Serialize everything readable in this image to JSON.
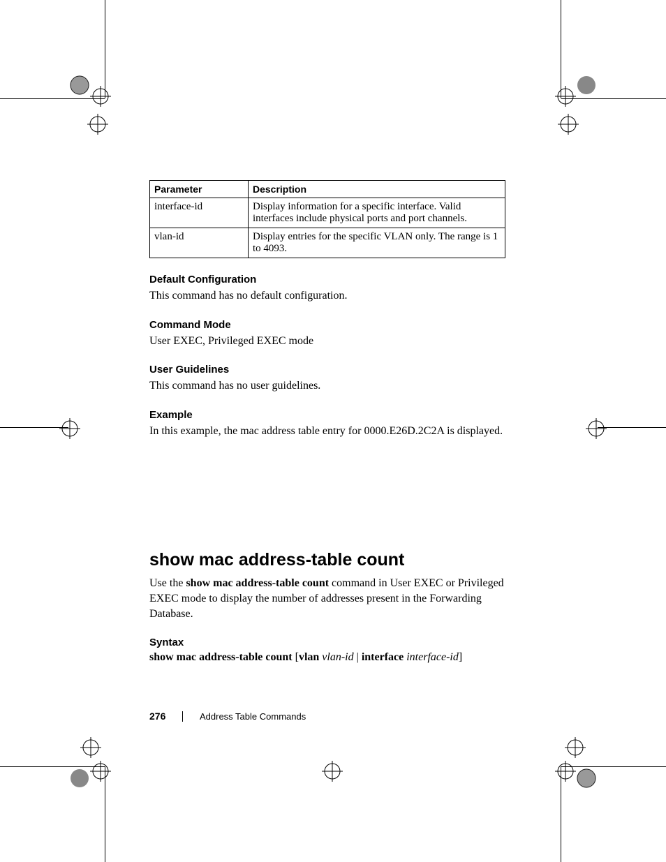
{
  "table": {
    "headers": {
      "param": "Parameter",
      "desc": "Description"
    },
    "rows": [
      {
        "param": "interface-id",
        "desc": "Display information for a specific interface. Valid interfaces include physical ports and port channels."
      },
      {
        "param": "vlan-id",
        "desc": "Display entries for the specific VLAN only. The range is 1 to 4093."
      }
    ]
  },
  "sections": {
    "default_cfg": {
      "heading": "Default Configuration",
      "body": "This command has no default configuration."
    },
    "cmd_mode": {
      "heading": "Command Mode",
      "body": "User EXEC, Privileged EXEC mode"
    },
    "user_guide": {
      "heading": "User Guidelines",
      "body": "This command has no user guidelines."
    },
    "example": {
      "heading": "Example",
      "body": "In this example, the mac address table entry for 0000.E26D.2C2A is displayed."
    }
  },
  "command": {
    "title": "show mac address-table count",
    "desc_parts": {
      "p1": "Use the ",
      "bold": "show mac address-table count",
      "p2": " command in User EXEC or Privileged EXEC mode to display the number of addresses present in the Forwarding Database."
    },
    "syntax_heading": "Syntax",
    "syntax": {
      "cmd": "show mac address-table count",
      "open": " [",
      "kw1": "vlan ",
      "arg1": "vlan-id",
      "sep": " | ",
      "kw2": "interface ",
      "arg2": "interface-id",
      "close": "]"
    }
  },
  "footer": {
    "page": "276",
    "chapter": "Address Table Commands"
  }
}
